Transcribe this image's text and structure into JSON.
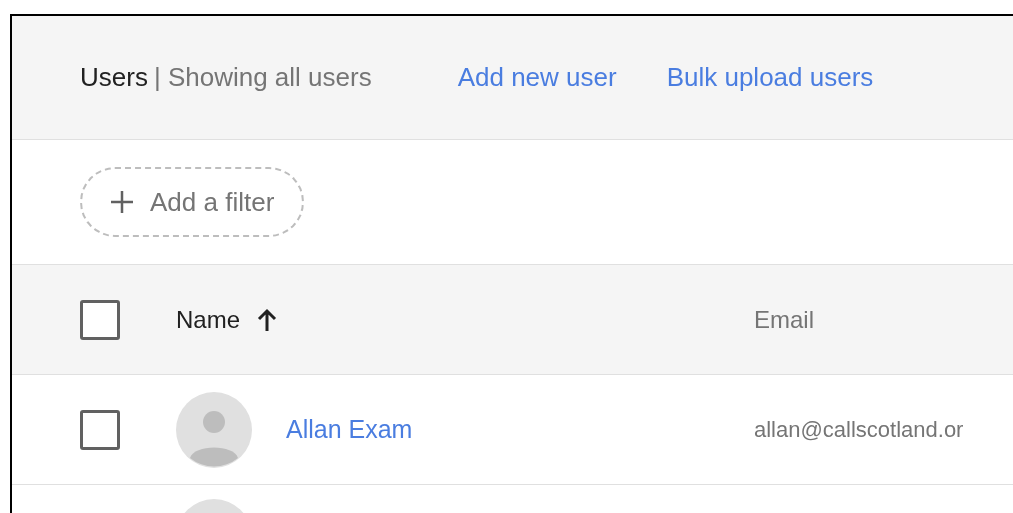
{
  "header": {
    "title": "Users",
    "subtitle": "| Showing all users",
    "actions": [
      "Add new user",
      "Bulk upload users"
    ]
  },
  "filter": {
    "label": "Add a filter"
  },
  "table": {
    "header_checked": false,
    "columns": [
      {
        "label": "Name",
        "sorted": true
      },
      {
        "label": "Email",
        "sorted": false
      }
    ],
    "rows": [
      {
        "name": "Allan Exam",
        "email": "allan@callscotland.or",
        "checked": false
      }
    ]
  }
}
